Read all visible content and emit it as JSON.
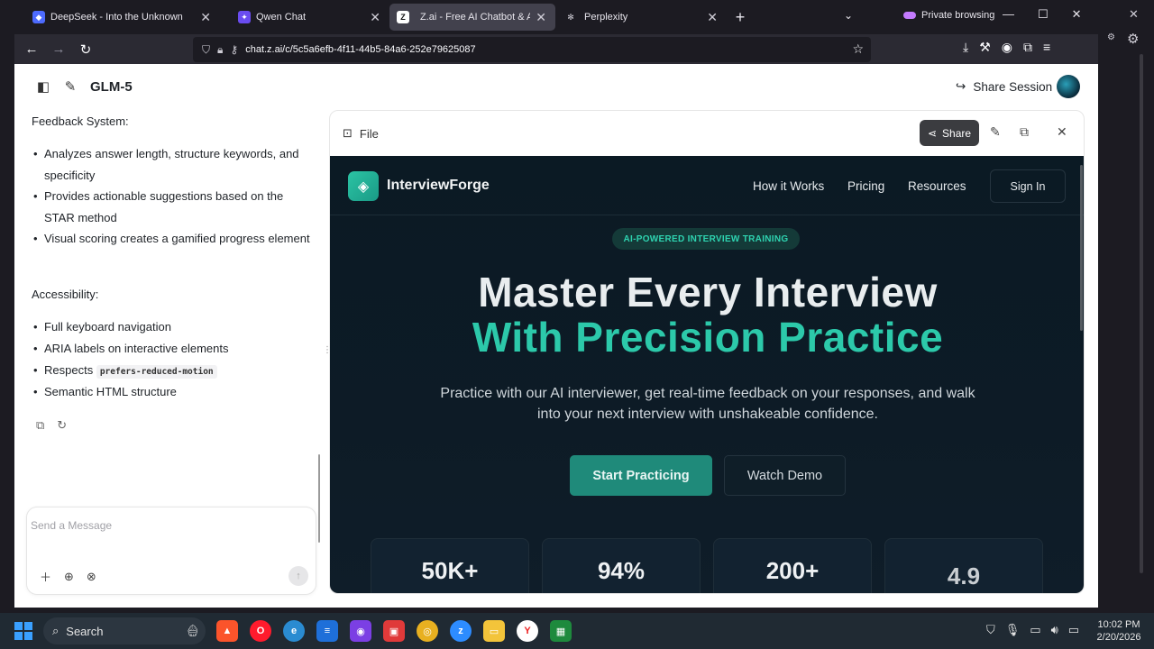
{
  "browser": {
    "tabs": [
      {
        "title": "DeepSeek - Into the Unknown",
        "active": false
      },
      {
        "title": "Qwen Chat",
        "active": false
      },
      {
        "title": "Z.ai - Free AI Chatbot & Agent powe",
        "active": true
      },
      {
        "title": "Perplexity",
        "active": false
      }
    ],
    "private_label": "Private browsing",
    "url": "chat.z.ai/c/5c5a6efb-4f11-44b5-84a6-252e79625087"
  },
  "app": {
    "model_name": "GLM-5",
    "share_session": "Share Session"
  },
  "chat": {
    "feedback_title": "Feedback System:",
    "feedback_items": [
      "Analyzes answer length, structure keywords, and specificity",
      "Provides actionable suggestions based on the STAR method",
      "Visual scoring creates a gamified progress element"
    ],
    "accessibility_title": "Accessibility:",
    "accessibility_items": [
      "Full keyboard navigation",
      "ARIA labels on interactive elements",
      "Respects",
      "Semantic HTML structure"
    ],
    "code_snippet": "prefers-reduced-motion",
    "composer_placeholder": "Send a Message"
  },
  "panel": {
    "file_label": "File",
    "share_label": "Share"
  },
  "preview": {
    "brand": "InterviewForge",
    "nav_links": [
      "How it Works",
      "Pricing",
      "Resources"
    ],
    "sign_in": "Sign In",
    "badge": "AI-POWERED INTERVIEW TRAINING",
    "hero_line1": "Master Every Interview",
    "hero_line2": "With Precision Practice",
    "subtitle": "Practice with our AI interviewer, get real-time feedback on your responses, and walk into your next interview with unshakeable confidence.",
    "cta_primary": "Start Practicing",
    "cta_secondary": "Watch Demo",
    "stats": [
      "50K+",
      "94%",
      "200+",
      "4.9"
    ]
  },
  "taskbar": {
    "search": "Search",
    "time": "10:02 PM",
    "date": "2/20/2026"
  },
  "colors": {
    "accent": "#2cc9aa",
    "primary_button": "#1f8a7a"
  }
}
